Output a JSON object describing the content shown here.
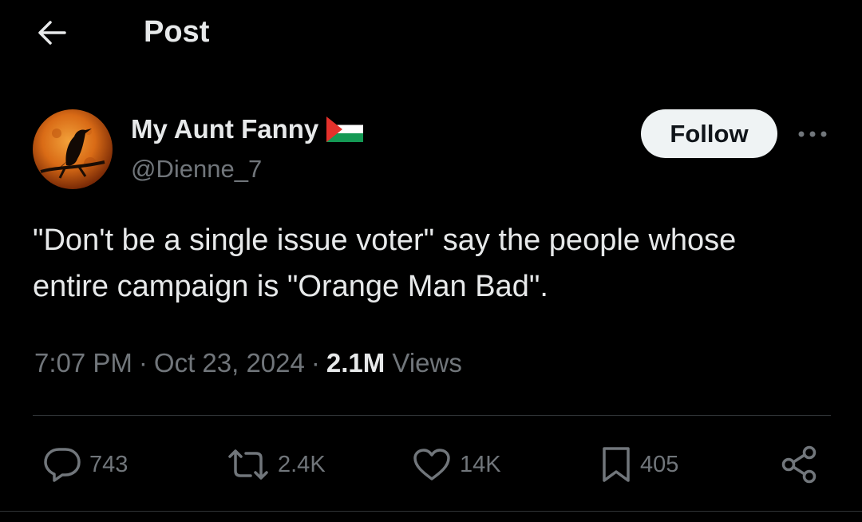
{
  "header": {
    "back_icon": "arrow-left-icon",
    "title": "Post"
  },
  "author": {
    "name": "My Aunt Fanny",
    "flag_icon": "palestine-flag-icon",
    "handle": "@Dienne_7",
    "avatar_icon": "crow-moon-avatar"
  },
  "follow_label": "Follow",
  "more_icon": "more-horizontal-icon",
  "tweet": {
    "text": "\"Don't be a single issue voter\" say the people whose\nentire campaign is \"Orange Man Bad\"."
  },
  "meta": {
    "time": "7:07 PM",
    "separator": "·",
    "date": "Oct 23, 2024",
    "views_count": "2.1M",
    "views_label": "Views"
  },
  "actions": {
    "reply": {
      "icon": "reply-icon",
      "count": "743"
    },
    "repost": {
      "icon": "repost-icon",
      "count": "2.4K"
    },
    "like": {
      "icon": "heart-icon",
      "count": "14K"
    },
    "bookmark": {
      "icon": "bookmark-icon",
      "count": "405"
    },
    "share": {
      "icon": "share-icon"
    }
  },
  "colors": {
    "background": "#000000",
    "text_primary": "#e7e9ea",
    "text_secondary": "#71767b",
    "follow_bg": "#eff3f4",
    "divider": "#2f3336"
  }
}
